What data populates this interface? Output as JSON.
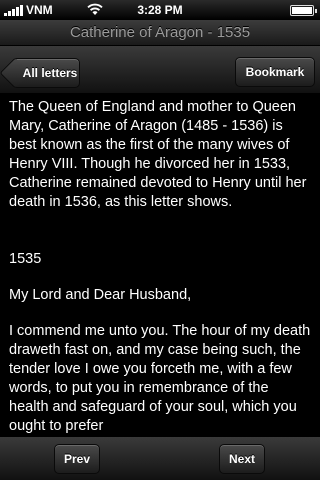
{
  "status": {
    "carrier": "VNM",
    "time": "3:28 PM",
    "battery_level": 1.0
  },
  "title": "Catherine of Aragon - 1535",
  "nav": {
    "back_label": "All letters",
    "bookmark_label": "Bookmark"
  },
  "content": {
    "intro": "The Queen of England and mother to Queen Mary, Catherine of Aragon (1485 - 1536) is best known as the first of the many wives of Henry VIII. Though he divorced her in 1533, Catherine remained devoted to Henry until her death in 1536, as this letter shows.",
    "year": "1535",
    "greeting": "My Lord and Dear Husband,",
    "body": "I commend me unto you. The hour of my death draweth fast on, and my case being such, the tender love I owe you forceth me, with a few words, to put you in remembrance of the health and safeguard of your soul, which you ought to prefer"
  },
  "toolbar": {
    "prev_label": "Prev",
    "next_label": "Next"
  }
}
